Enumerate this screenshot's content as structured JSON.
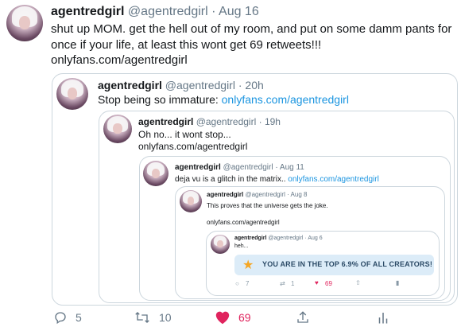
{
  "tweet": {
    "name": "agentredgirl",
    "handle": "@agentredgirl",
    "date": "Aug 16",
    "text": "shut up MOM. get the hell out of my room, and put on some damm pants for once if your life, at least this wont get 69 retweets!!!",
    "link": "onlyfans.com/agentredgirl"
  },
  "quote1": {
    "name": "agentredgirl",
    "handle": "@agentredgirl",
    "date": "20h",
    "text": "Stop being so immature:",
    "link": "onlyfans.com/agentredgirl"
  },
  "quote2": {
    "name": "agentredgirl",
    "handle": "@agentredgirl",
    "date": "19h",
    "text": "Oh no... it wont stop...",
    "link": "onlyfans.com/agentredgirl"
  },
  "quote3": {
    "name": "agentredgirl",
    "handle": "@agentredgirl",
    "date": "Aug 11",
    "text": "deja vu is a glitch in the matrix..",
    "link": "onlyfans.com/agentredgirl"
  },
  "quote4": {
    "name": "agentredgirl",
    "handle": "@agentredgirl",
    "date": "Aug 8",
    "text": "This proves that the universe gets the joke.",
    "link": "onlyfans.com/agentredgirl"
  },
  "quote5": {
    "name": "agentredgirl",
    "handle": "@agentredgirl",
    "date": "Aug 6",
    "text": "heh...",
    "banner": "YOU ARE IN THE TOP 6.9% OF ALL CREATORS!",
    "actions": {
      "replies": "7",
      "retweets": "1",
      "likes": "69"
    }
  },
  "actions": {
    "replies": "5",
    "retweets": "10",
    "likes": "69"
  },
  "colors": {
    "like": "#e0245e",
    "link": "#1b95e0",
    "muted": "#657786",
    "border": "#ccd6dd"
  }
}
